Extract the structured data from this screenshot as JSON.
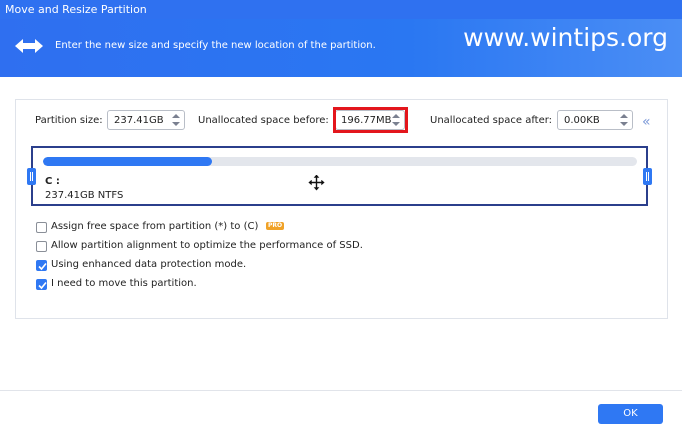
{
  "window": {
    "title": "Move and Resize Partition"
  },
  "header": {
    "description": "Enter the new size and specify the new location of the partition.",
    "watermark": "www.wintips.org"
  },
  "sizes": {
    "partition_size_label": "Partition size:",
    "partition_size_value": "237.41GB",
    "unalloc_before_label": "Unallocated space before:",
    "unalloc_before_value": "196.77MB",
    "unalloc_after_label": "Unallocated space after:",
    "unalloc_after_value": "0.00KB",
    "collapse_glyph": "«"
  },
  "partition": {
    "drive": "C :",
    "info": "237.41GB NTFS",
    "used_fraction": 0.285
  },
  "options": [
    {
      "label": "Assign free space from partition (*) to (C)",
      "checked": false,
      "badge": "PRO"
    },
    {
      "label": "Allow partition alignment to optimize the performance of SSD.",
      "checked": false
    },
    {
      "label": "Using enhanced data protection mode.",
      "checked": true
    },
    {
      "label": "I need to move this partition.",
      "checked": true
    }
  ],
  "footer": {
    "ok_label": "OK"
  },
  "colors": {
    "accent": "#2f78f3",
    "highlight": "#e3161c",
    "header": "#2f71f0"
  }
}
